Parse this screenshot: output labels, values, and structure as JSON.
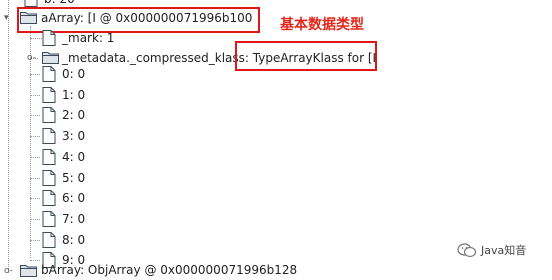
{
  "tree": {
    "top_row": "b: 20",
    "aArray_label": "aArray: [I @ 0x000000071996b100",
    "mark_label": "_mark: 1",
    "metadata_label": "_metadata._compressed_klass: TypeArrayKlass for [I",
    "elements": [
      {
        "label": "0: 0"
      },
      {
        "label": "1: 0"
      },
      {
        "label": "2: 0"
      },
      {
        "label": "3: 0"
      },
      {
        "label": "4: 0"
      },
      {
        "label": "5: 0"
      },
      {
        "label": "6: 0"
      },
      {
        "label": "7: 0"
      },
      {
        "label": "8: 0"
      },
      {
        "label": "9: 0"
      }
    ],
    "bottom_row": "bArray: ObjArray @ 0x000000071996b128"
  },
  "annotation": {
    "text": "基本数据类型",
    "color": "#e5271b"
  },
  "watermark": {
    "text": "Java知音"
  },
  "colors": {
    "highlight_box": "#e0161b",
    "tree_line": "#9a9a9a"
  }
}
